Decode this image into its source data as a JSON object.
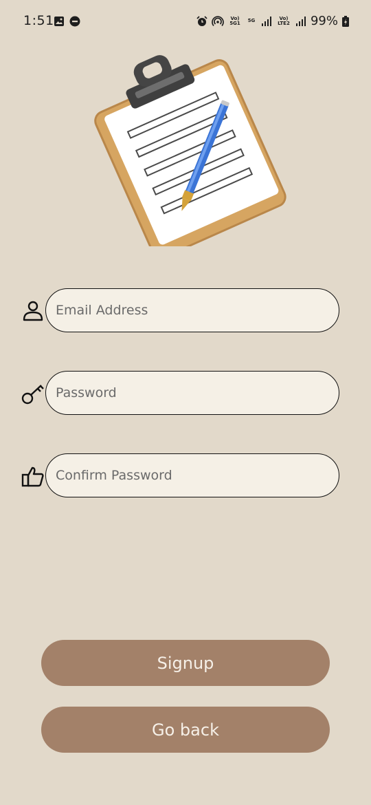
{
  "status_bar": {
    "time": "1:51",
    "battery": "99%",
    "network_labels": [
      "Vo) 5G1",
      "5G",
      "Vo) LTE2"
    ]
  },
  "form": {
    "email_placeholder": "Email Address",
    "password_placeholder": "Password",
    "confirm_placeholder": "Confirm Password"
  },
  "buttons": {
    "signup": "Signup",
    "go_back": "Go back"
  },
  "icons": {
    "email": "person-icon",
    "password": "key-icon",
    "confirm": "thumbs-up-icon",
    "hero": "clipboard-with-pen-icon"
  },
  "colors": {
    "background": "#e2d9ca",
    "input_fill": "#f5f0e6",
    "button": "#a38169",
    "button_text": "#f6f0e8"
  }
}
